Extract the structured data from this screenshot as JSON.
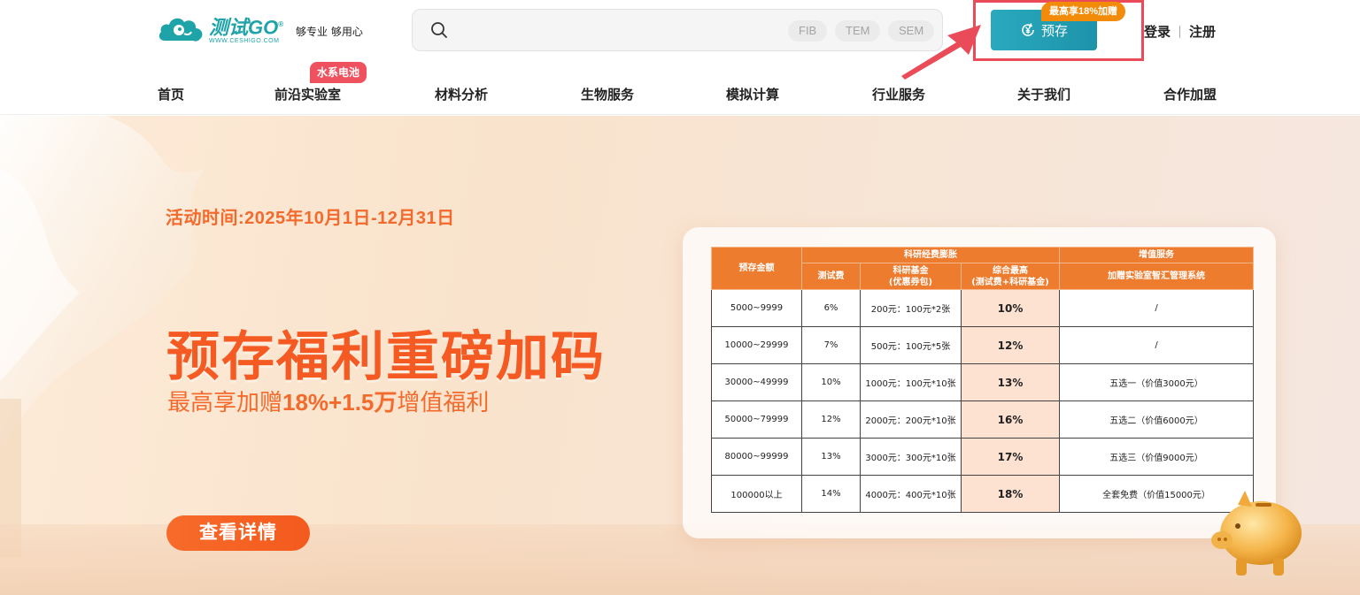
{
  "brand": {
    "name": "测试GO",
    "registered": "®",
    "url": "WWW.CESHIGO.COM",
    "slogan": "够专业 够用心"
  },
  "search": {
    "placeholder": "",
    "tags": [
      "FIB",
      "TEM",
      "SEM"
    ]
  },
  "header": {
    "deposit_label": "预存",
    "deposit_badge": "最高享18%加赠",
    "login": "登录",
    "register": "注册"
  },
  "nav": {
    "items": [
      "首页",
      "前沿实验室",
      "材料分析",
      "生物服务",
      "模拟计算",
      "行业服务",
      "关于我们",
      "合作加盟"
    ],
    "badge": "水系电池"
  },
  "banner": {
    "activity": "活动时间:2025年10月1日-12月31日",
    "headline": "预存福利重磅加码",
    "sub_prefix": "最高享加赠",
    "sub_bold": "18%+1.5万",
    "sub_suffix": "增值福利",
    "detail_button": "查看详情"
  },
  "rates_table": {
    "group_headers": {
      "amount": "预存金额",
      "research": "科研经费膨胀",
      "value_added": "增值服务"
    },
    "col_headers": {
      "test_fee": "测试费",
      "fund": "科研基金",
      "fund_note": "(优惠券包)",
      "combined": "综合最高",
      "combined_note": "(测试费+科研基金)",
      "system": "加赠实验室智汇管理系统"
    },
    "rows": [
      {
        "amount": "5000~9999",
        "fee": "6%",
        "fund": "200元：100元*2张",
        "max": "10%",
        "service": "/"
      },
      {
        "amount": "10000~29999",
        "fee": "7%",
        "fund": "500元：100元*5张",
        "max": "12%",
        "service": "/"
      },
      {
        "amount": "30000~49999",
        "fee": "10%",
        "fund": "1000元：100元*10张",
        "max": "13%",
        "service": "五选一（价值3000元）"
      },
      {
        "amount": "50000~79999",
        "fee": "12%",
        "fund": "2000元：200元*10张",
        "max": "16%",
        "service": "五选二（价值6000元）"
      },
      {
        "amount": "80000~99999",
        "fee": "13%",
        "fund": "3000元：300元*10张",
        "max": "17%",
        "service": "五选三（价值9000元）"
      },
      {
        "amount": "100000以上",
        "fee": "14%",
        "fund": "4000元：400元*10张",
        "max": "18%",
        "service": "全套免费（价值15000元）"
      }
    ]
  },
  "colors": {
    "brand_teal": "#1ea3a8",
    "accent_orange": "#f55a23",
    "highlight_red": "#ea4b58"
  }
}
